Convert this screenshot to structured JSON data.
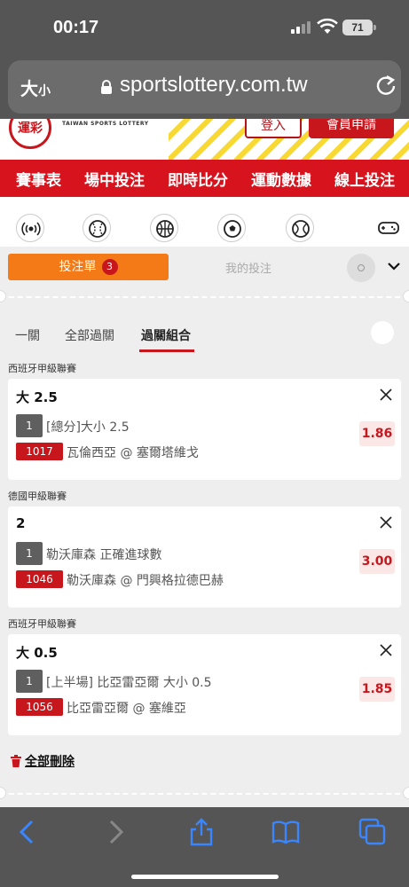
{
  "status_bar": {
    "time": "00:17",
    "battery": "71"
  },
  "url_bar": {
    "text_size": "大",
    "text_size_small": "小",
    "url": "sportslottery.com.tw"
  },
  "site_header": {
    "logo_text": "運彩",
    "logo_subtitle": "TAIWAN SPORTS LOTTERY",
    "login_label": "登入",
    "join_label": "會員申請"
  },
  "main_nav": {
    "items": [
      "賽事表",
      "場中投注",
      "即時比分",
      "運動數據",
      "線上投注"
    ]
  },
  "sports_icons": [
    "live-broadcast-icon",
    "baseball-icon",
    "basketball-icon",
    "soccer-icon",
    "tennis-icon",
    "esports-controller-icon"
  ],
  "bet_slip": {
    "tab_label": "投注單",
    "tab_count": "3",
    "my_bets_label": "我的投注",
    "subtabs": [
      "一關",
      "全部過關",
      "過關組合"
    ],
    "active_subtab": "過關組合",
    "bets": [
      {
        "league": "西班牙甲級聯賽",
        "title": "大 2.5",
        "leg": "1",
        "description": "[總分]大小 2.5",
        "code": "1017",
        "match": "瓦倫西亞 @ 塞爾塔維戈",
        "odds": "1.86"
      },
      {
        "league": "德國甲級聯賽",
        "title": "2",
        "leg": "1",
        "description": "勒沃庫森 正確進球數",
        "code": "1046",
        "match": "勒沃庫森 @ 門興格拉德巴赫",
        "odds": "3.00"
      },
      {
        "league": "西班牙甲級聯賽",
        "title": "大 0.5",
        "leg": "1",
        "description": "[上半場] 比亞雷亞爾 大小 0.5",
        "code": "1056",
        "match": "比亞雷亞爾 @ 塞維亞",
        "odds": "1.85"
      }
    ],
    "delete_all_label": "全部刪除"
  },
  "colors": {
    "brand_red": "#d7141d",
    "slip_orange": "#f47a17",
    "odds_bg": "#fbe8e6",
    "safari_blue": "#3a86ff"
  }
}
